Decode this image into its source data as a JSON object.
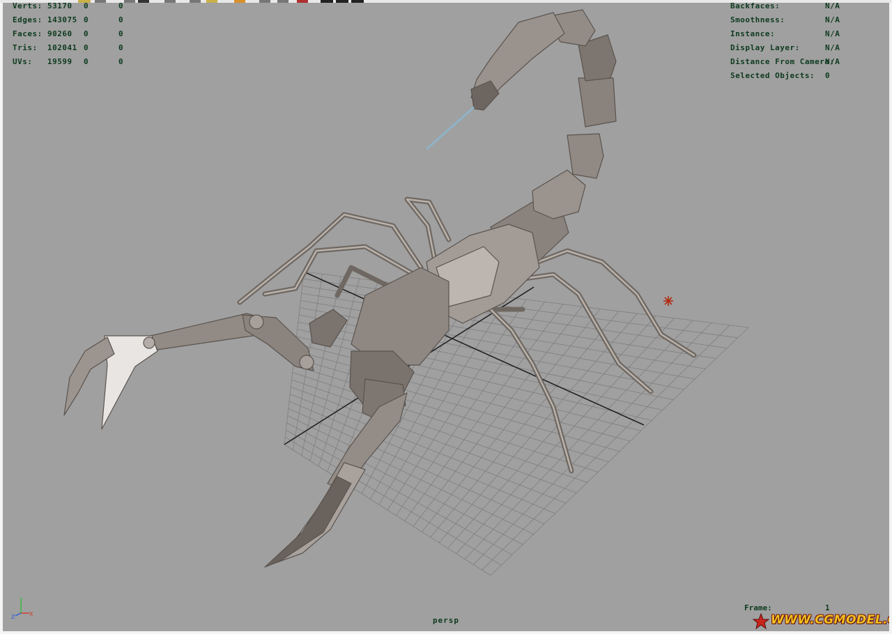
{
  "viewport": {
    "camera": "persp",
    "background": "#a0a0a0"
  },
  "hud_left": {
    "rows": [
      {
        "label": "Verts:",
        "total": "53170",
        "selected": "0",
        "components": "0"
      },
      {
        "label": "Edges:",
        "total": "143075",
        "selected": "0",
        "components": "0"
      },
      {
        "label": "Faces:",
        "total": "90260",
        "selected": "0",
        "components": "0"
      },
      {
        "label": "Tris:",
        "total": "102041",
        "selected": "0",
        "components": "0"
      },
      {
        "label": "UVs:",
        "total": "19599",
        "selected": "0",
        "components": "0"
      }
    ]
  },
  "hud_right": {
    "rows": [
      {
        "label": "Backfaces:",
        "value": "N/A"
      },
      {
        "label": "Smoothness:",
        "value": "N/A"
      },
      {
        "label": "Instance:",
        "value": "N/A"
      },
      {
        "label": "Display Layer:",
        "value": "N/A"
      },
      {
        "label": "Distance From Camera:",
        "value": "N/A"
      },
      {
        "label": "Selected Objects:",
        "value": "0"
      }
    ]
  },
  "frame": {
    "label": "Frame:",
    "value": "1"
  },
  "axis": {
    "x": "X",
    "y": "Y",
    "z": "Z"
  },
  "watermark": {
    "text": "WWW.CGMODEL.CN",
    "icon": "star-icon"
  },
  "colors": {
    "hud_text": "#0d3a1e",
    "model": "#8e8680",
    "grid": "#7e7e7e",
    "stinger": "#8fb3c8",
    "light": "#b02a10"
  }
}
